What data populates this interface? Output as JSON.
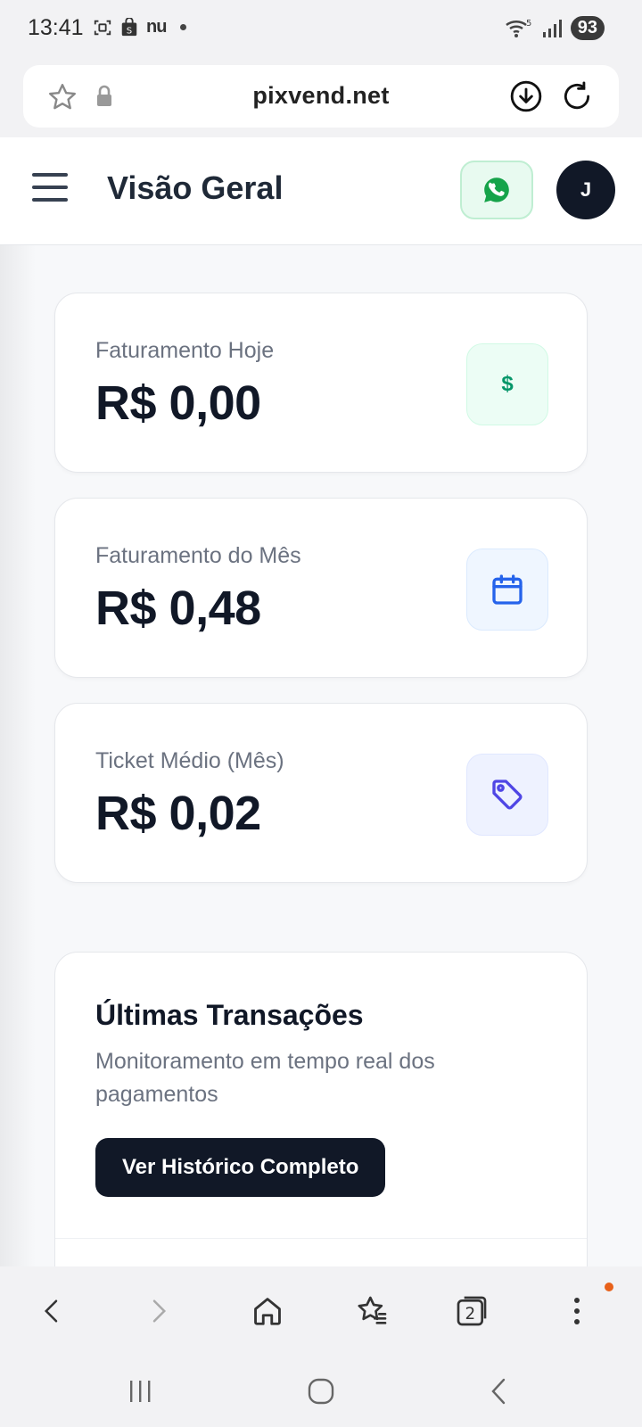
{
  "status_bar": {
    "time": "13:41",
    "carrier_badge": "nu",
    "wifi_badge": "5",
    "battery": "93",
    "icons": [
      "screenshot-icon",
      "shopping-bag-icon",
      "notification-dot",
      "wifi-icon",
      "signal-icon",
      "battery-icon"
    ]
  },
  "browser": {
    "url": "pixvend.net",
    "icons": [
      "star-icon",
      "lock-icon",
      "download-icon",
      "reload-icon"
    ]
  },
  "header": {
    "title": "Visão Geral",
    "avatar_initial": "J",
    "icons": [
      "menu-icon",
      "whatsapp-icon"
    ]
  },
  "stats": [
    {
      "label": "Faturamento Hoje",
      "value": "R$ 0,00",
      "icon": "dollar-icon",
      "icon_glyph": "$",
      "icon_color": "#059669"
    },
    {
      "label": "Faturamento do Mês",
      "value": "R$ 0,48",
      "icon": "calendar-icon",
      "icon_color": "#2563eb"
    },
    {
      "label": "Ticket Médio (Mês)",
      "value": "R$ 0,02",
      "icon": "tag-icon",
      "icon_color": "#4f46e5"
    }
  ],
  "transactions": {
    "title": "Últimas Transações",
    "subtitle": "Monitoramento em tempo real dos pagamentos",
    "button_label": "Ver Histórico Completo"
  },
  "browser_nav": {
    "tabs_count": "2",
    "icons": [
      "back-icon",
      "forward-icon",
      "home-icon",
      "bookmarks-icon",
      "tabs-icon",
      "more-icon"
    ]
  },
  "system_nav": {
    "icons": [
      "recents-icon",
      "home-circle-icon",
      "back-chevron-icon"
    ]
  },
  "colors": {
    "primary_dark": "#111827",
    "muted_text": "#6b7280",
    "whatsapp_green": "#16a34a",
    "accent_dot": "#e8611a"
  }
}
